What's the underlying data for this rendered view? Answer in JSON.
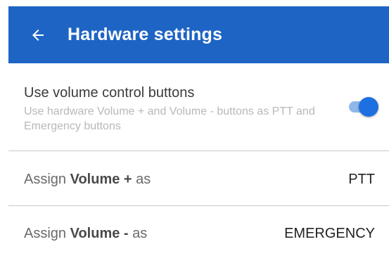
{
  "header": {
    "title": "Hardware settings",
    "back_icon": "arrow-left-icon",
    "background_color": "#1e64c4"
  },
  "volume_setting": {
    "title": "Use volume control buttons",
    "description": "Use hardware Volume + and Volume - buttons as PTT and Emergency buttons",
    "enabled": true,
    "switch_color": "#1e6fe0"
  },
  "assignments": [
    {
      "prefix": "Assign ",
      "button": "Volume +",
      "suffix": " as",
      "value": "PTT"
    },
    {
      "prefix": "Assign ",
      "button": "Volume -",
      "suffix": " as",
      "value": "EMERGENCY"
    }
  ]
}
